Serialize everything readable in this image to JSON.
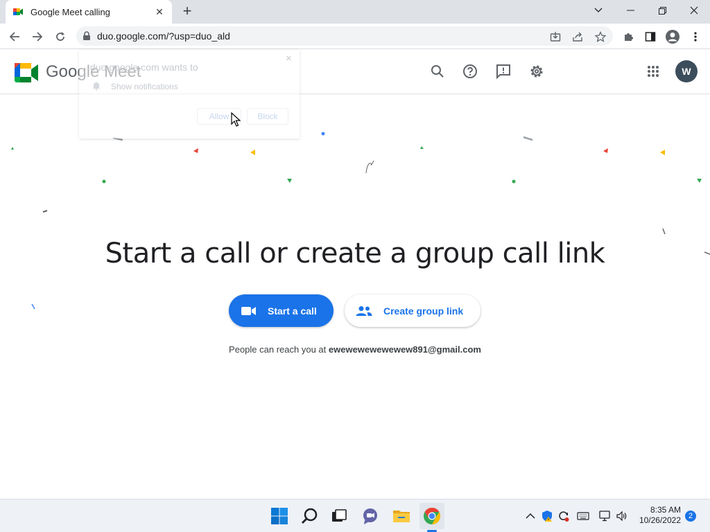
{
  "browser": {
    "tab_title": "Google Meet calling",
    "new_tab_label": "+",
    "url": "duo.google.com/?usp=duo_ald"
  },
  "header": {
    "brand": "Google Meet",
    "avatar_letter": "W"
  },
  "notification_prompt": {
    "title": "duo.google.com wants to",
    "permission": "Show notifications",
    "allow_label": "Allow",
    "block_label": "Block",
    "close_label": "×"
  },
  "main": {
    "headline": "Start a call or create a group call link",
    "start_call_label": "Start a call",
    "create_group_label": "Create group link",
    "reach_prefix": "People can reach you at",
    "reach_email": "ewewewewewewew891@gmail.com"
  },
  "taskbar": {
    "time": "8:35 AM",
    "date": "10/26/2022",
    "notification_count": "2"
  },
  "colors": {
    "accent": "#1a73e8",
    "avatar": "#3c4d5b"
  }
}
